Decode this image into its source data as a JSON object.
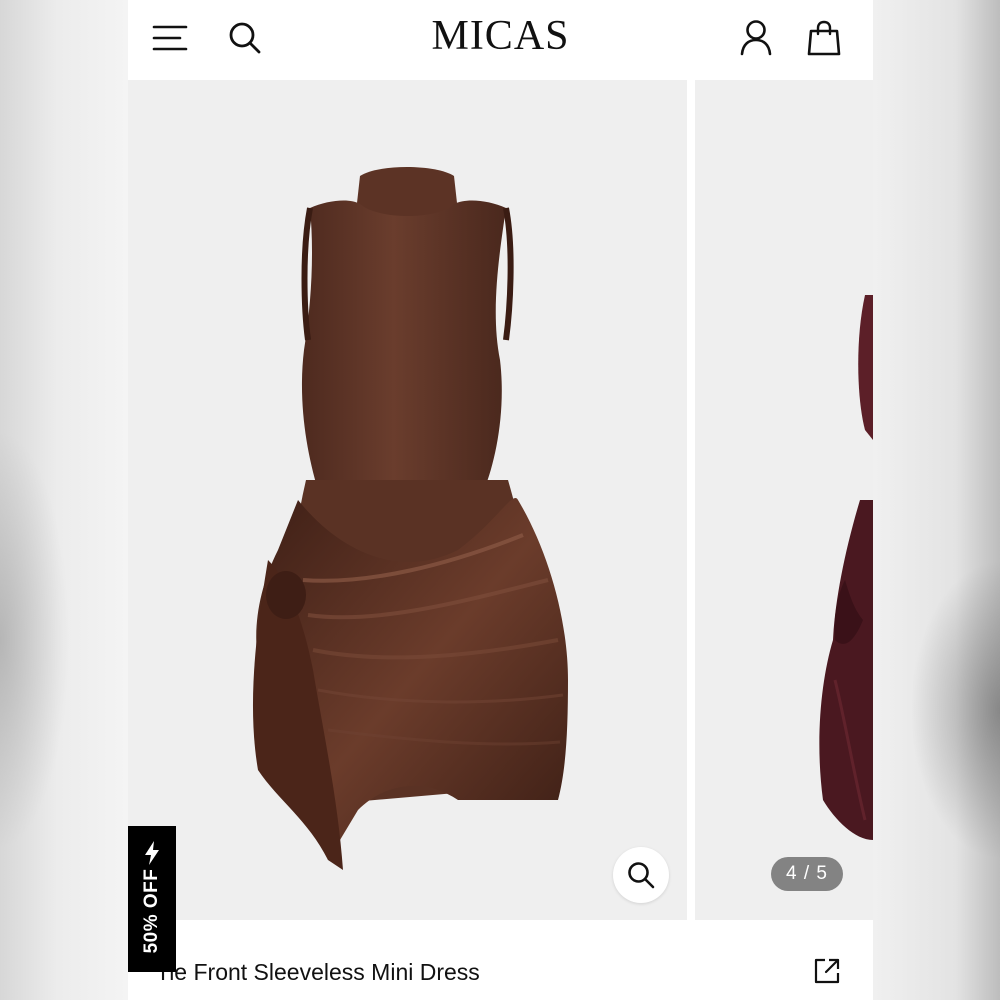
{
  "header": {
    "brand": "MICAS",
    "icons": [
      "menu-icon",
      "search-icon",
      "account-icon",
      "shopping-bag-icon"
    ]
  },
  "gallery": {
    "counter": "4 / 5",
    "current_index": 4,
    "total": 5,
    "zoom_icon": "search-icon"
  },
  "badge": {
    "label": "50% OFF",
    "icon": "lightning-bolt-icon"
  },
  "product": {
    "title": "Tie Front Sleeveless Mini Dress",
    "share_icon": "share-icon"
  },
  "colors": {
    "dress_brown": "#5a3326",
    "dress_burgundy": "#5c1f28",
    "image_bg": "#efefef",
    "badge_bg": "#000000",
    "counter_bg": "#646464"
  }
}
